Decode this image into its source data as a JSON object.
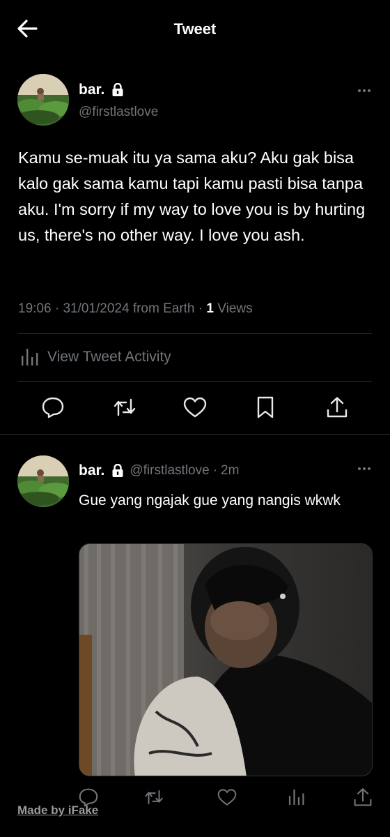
{
  "header": {
    "title": "Tweet"
  },
  "main_tweet": {
    "display_name": "bar.",
    "handle": "@firstlastlove",
    "text": "Kamu se-muak itu ya sama aku? Aku gak bisa kalo gak sama kamu tapi kamu pasti bisa tanpa aku. I'm sorry if my way to love you is by hurting us, there's no other way. I love you ash.",
    "time": "19:06",
    "date": "31/01/2024",
    "source": "from Earth",
    "views_count": "1",
    "views_label": "Views",
    "activity_label": "View Tweet Activity"
  },
  "reply": {
    "display_name": "bar.",
    "handle": "@firstlastlove",
    "age": "2m",
    "text": "Gue yang ngajak gue yang nangis wkwk"
  },
  "watermark": "Made by iFake",
  "colors": {
    "background": "#000000",
    "text": "#ffffff",
    "muted": "#71767b",
    "divider": "#2f3336"
  },
  "icons": [
    "arrow-left-icon",
    "lock-icon",
    "more-dots-icon",
    "bar-chart-icon",
    "reply-icon",
    "retweet-icon",
    "like-icon",
    "bookmark-icon",
    "share-icon"
  ]
}
